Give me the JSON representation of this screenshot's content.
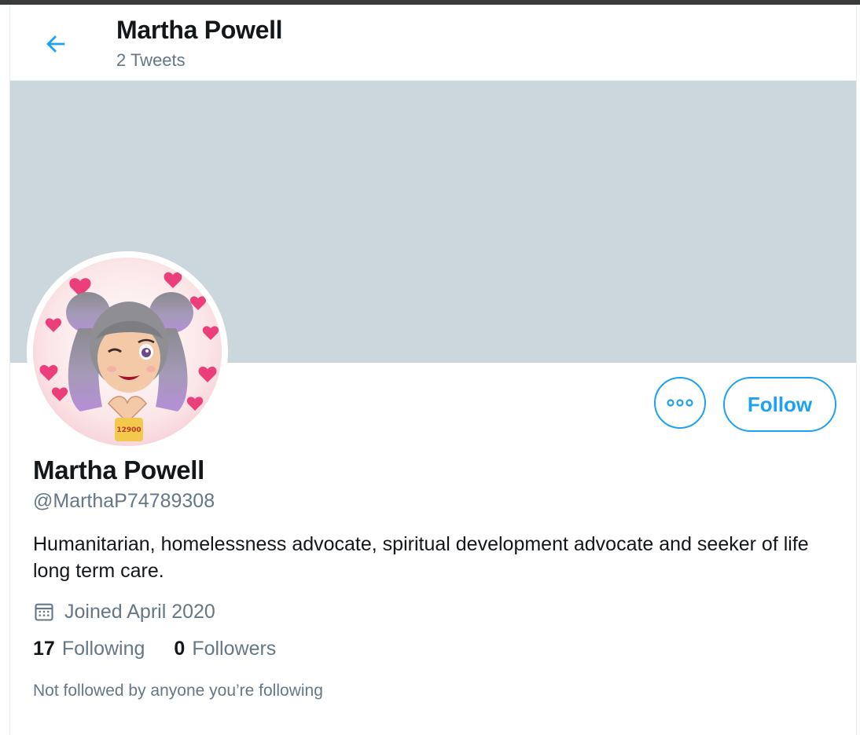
{
  "header": {
    "name": "Martha Powell",
    "tweet_count": "2 Tweets",
    "back_icon": "arrow-left-icon"
  },
  "profile": {
    "name": "Martha Powell",
    "handle": "@MarthaP74789308",
    "bio": "Humanitarian, homelessness advocate, spiritual development advocate and seeker of life long term care.",
    "joined": "Joined April 2020",
    "following_count": "17",
    "following_label": "Following",
    "followers_count": "0",
    "followers_label": "Followers",
    "not_followed": "Not followed by anyone you’re following",
    "avatar_badge_text": "12900"
  },
  "actions": {
    "more_icon": "more-options-icon",
    "follow_label": "Follow"
  },
  "colors": {
    "accent": "#1da1f2",
    "secondary_text": "#657786",
    "banner": "#ccd6dd"
  }
}
